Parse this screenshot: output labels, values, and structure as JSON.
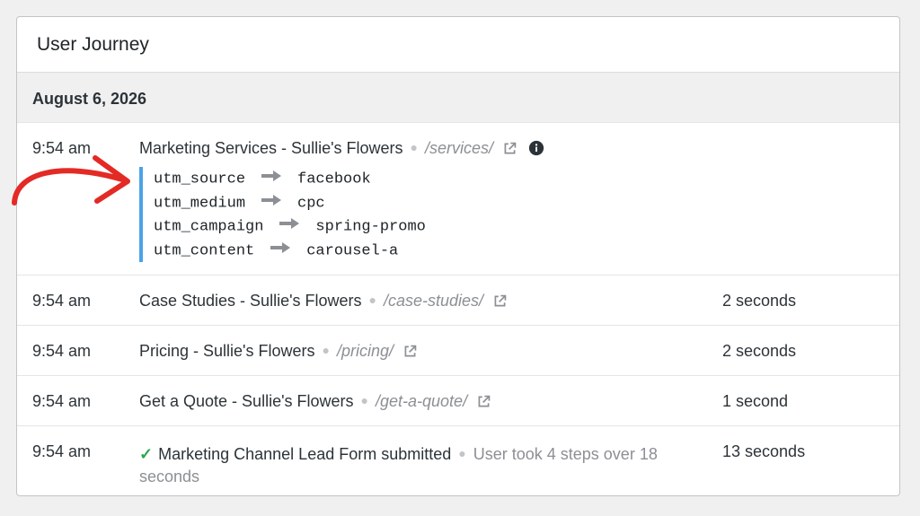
{
  "panel": {
    "title": "User Journey"
  },
  "journey": {
    "date": "August 6, 2026",
    "first": {
      "time": "9:54 am",
      "title": "Marketing Services - Sullie's Flowers",
      "path": "/services/",
      "utm": [
        {
          "key": "utm_source",
          "value": "facebook"
        },
        {
          "key": "utm_medium",
          "value": "cpc"
        },
        {
          "key": "utm_campaign",
          "value": "spring-promo"
        },
        {
          "key": "utm_content",
          "value": "carousel-a"
        }
      ]
    },
    "steps": [
      {
        "time": "9:54 am",
        "title": "Case Studies - Sullie's Flowers",
        "path": "/case-studies/",
        "duration": "2 seconds"
      },
      {
        "time": "9:54 am",
        "title": "Pricing - Sullie's Flowers",
        "path": "/pricing/",
        "duration": "2 seconds"
      },
      {
        "time": "9:54 am",
        "title": "Get a Quote - Sullie's Flowers",
        "path": "/get-a-quote/",
        "duration": "1 second"
      }
    ],
    "submission": {
      "time": "9:54 am",
      "title": "Marketing Channel Lead Form submitted",
      "summary": "User took 4 steps over 18 seconds",
      "duration": "13 seconds"
    }
  },
  "icons": {
    "external": "external-link-icon",
    "info": "info-icon",
    "arrow": "right-arrow-icon",
    "check": "checkmark-icon"
  },
  "colors": {
    "utm_border": "#4aa3e8",
    "check": "#2ea44f",
    "annotation": "#e32a25",
    "muted": "#8c8f94"
  }
}
